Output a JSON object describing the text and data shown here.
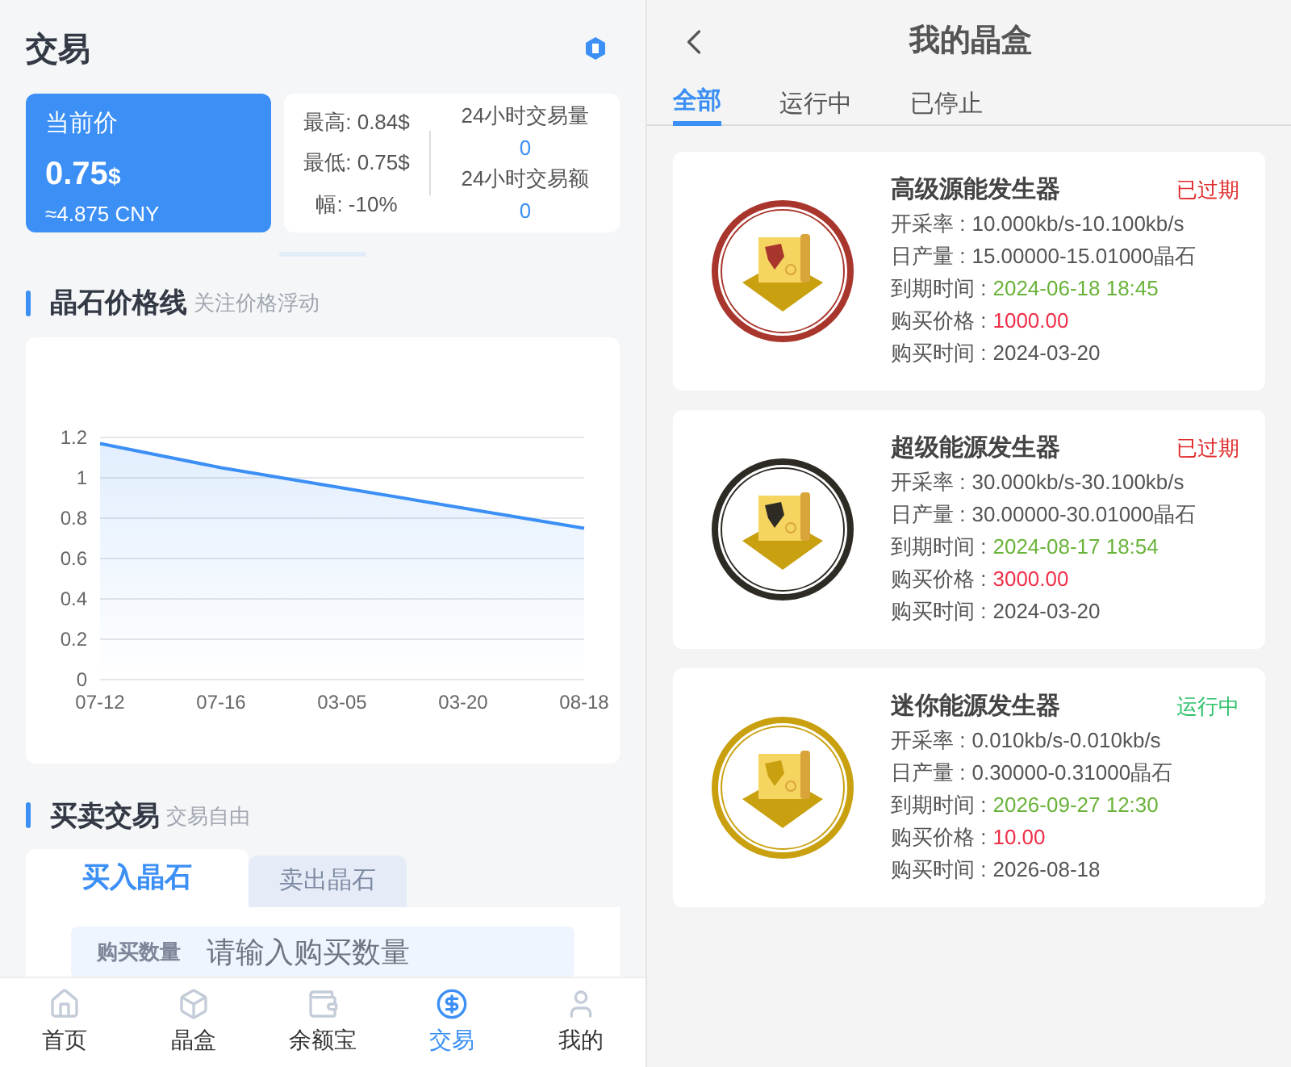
{
  "left": {
    "title": "交易",
    "price_card": {
      "label": "当前价",
      "price": "0.75",
      "unit": "$",
      "cny": "≈4.875 CNY"
    },
    "stats": {
      "items": [
        "最高: 0.84$",
        "最低: 0.75$",
        "幅: -10%"
      ],
      "volume_label": "24小时交易量",
      "volume": "0",
      "amount_label": "24小时交易额",
      "amount": "0"
    },
    "chart_section": {
      "title": "晶石价格线",
      "subtitle": "关注价格浮动",
      "chart_data": {
        "type": "area",
        "categories": [
          "07-12",
          "07-16",
          "03-05",
          "03-20",
          "08-18"
        ],
        "series": [
          {
            "color": "#3b8ff5",
            "values": [
              1.17,
              1.05,
              0.95,
              0.85,
              0.75
            ]
          }
        ],
        "grid": true,
        "ylim": [
          0,
          1.2
        ],
        "yticks": [
          0,
          0.2,
          0.4,
          0.6,
          0.8,
          1,
          1.2
        ]
      }
    },
    "trade_section": {
      "title": "买卖交易",
      "subtitle": "交易自由",
      "tabs": [
        {
          "label": "买入晶石",
          "selected": true
        },
        {
          "label": "卖出晶石",
          "selected": false
        }
      ],
      "field_label": "购买数量",
      "placeholder": "请输入购买数量"
    },
    "nav": [
      {
        "label": "首页",
        "kind": "home",
        "selected": false
      },
      {
        "label": "晶盒",
        "kind": "box",
        "selected": false
      },
      {
        "label": "余额宝",
        "kind": "wallet",
        "selected": false
      },
      {
        "label": "交易",
        "kind": "dollar",
        "selected": true
      },
      {
        "label": "我的",
        "kind": "user",
        "selected": false
      }
    ]
  },
  "right": {
    "title": "我的晶盒",
    "tabs": [
      {
        "label": "全部",
        "selected": true
      },
      {
        "label": "运行中",
        "selected": false
      },
      {
        "label": "已停止",
        "selected": false
      }
    ],
    "cards": [
      {
        "name": "高级源能发生器",
        "status": "已过期",
        "kind": "expired",
        "color": "#a8362c",
        "rows": [
          {
            "label": "开采率 :",
            "value": "10.000kb/s-10.100kb/s",
            "kind": "plain"
          },
          {
            "label": "日产量 :",
            "value": "15.00000-15.01000晶石",
            "kind": "plain"
          },
          {
            "label": "到期时间 :",
            "value": "2024-06-18 18:45",
            "kind": "date"
          },
          {
            "label": "购买价格 :",
            "value": "1000.00",
            "kind": "price"
          },
          {
            "label": "购买时间 :",
            "value": "2024-03-20",
            "kind": "plain"
          }
        ]
      },
      {
        "name": "超级能源发生器",
        "status": "已过期",
        "kind": "expired",
        "color": "#2e2a24",
        "rows": [
          {
            "label": "开采率 :",
            "value": "30.000kb/s-30.100kb/s",
            "kind": "plain"
          },
          {
            "label": "日产量 :",
            "value": "30.00000-30.01000晶石",
            "kind": "plain"
          },
          {
            "label": "到期时间 :",
            "value": "2024-08-17 18:54",
            "kind": "date"
          },
          {
            "label": "购买价格 :",
            "value": "3000.00",
            "kind": "price"
          },
          {
            "label": "购买时间 :",
            "value": "2024-03-20",
            "kind": "plain"
          }
        ]
      },
      {
        "name": "迷你能源发生器",
        "status": "运行中",
        "kind": "running",
        "color": "#c9a010",
        "rows": [
          {
            "label": "开采率 :",
            "value": "0.010kb/s-0.010kb/s",
            "kind": "plain"
          },
          {
            "label": "日产量 :",
            "value": "0.30000-0.31000晶石",
            "kind": "plain"
          },
          {
            "label": "到期时间 :",
            "value": "2026-09-27 12:30",
            "kind": "date"
          },
          {
            "label": "购买价格 :",
            "value": "10.00",
            "kind": "price"
          },
          {
            "label": "购买时间 :",
            "value": "2026-08-18",
            "kind": "plain"
          }
        ]
      }
    ]
  }
}
